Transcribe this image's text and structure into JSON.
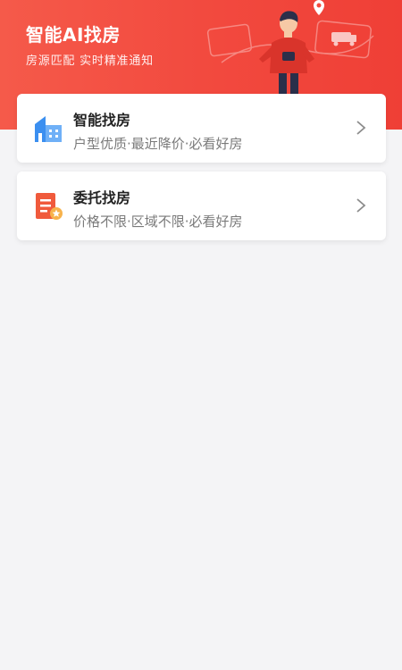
{
  "header": {
    "title": "智能AI找房",
    "subtitle": "房源匹配 实时精准通知",
    "illustration": "person-with-map-and-house-illustration"
  },
  "cards": [
    {
      "title": "智能找房",
      "description": "户型优质·最近降价·必看好房",
      "icon": "buildings-icon",
      "icon_color": "#3b8ff0"
    },
    {
      "title": "委托找房",
      "description": "价格不限·区域不限·必看好房",
      "icon": "document-commission-icon",
      "icon_color": "#f05a3c"
    }
  ],
  "colors": {
    "header_bg": "#f24a3f",
    "page_bg": "#f4f4f6",
    "title_text": "#222222",
    "desc_text": "#7a7a7a"
  }
}
